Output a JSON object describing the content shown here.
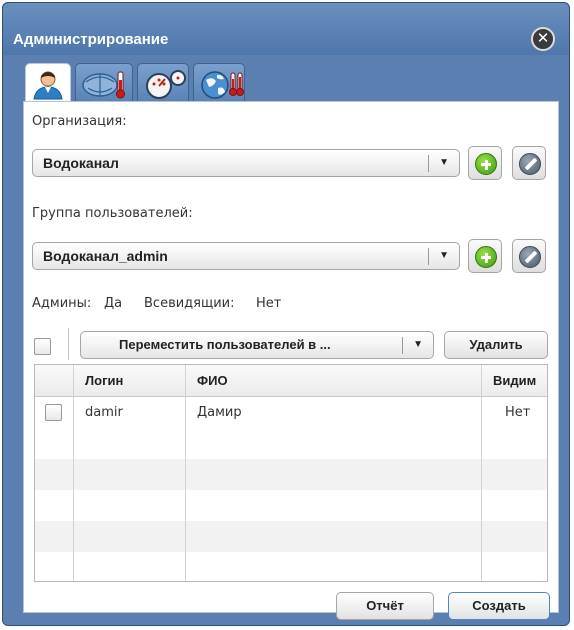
{
  "window": {
    "title": "Администрирование",
    "close_glyph": "✕"
  },
  "tabs": [
    {
      "name": "users",
      "icon": "user-icon",
      "active": true
    },
    {
      "name": "network-settings",
      "icon": "network-thermometer-icon",
      "active": false
    },
    {
      "name": "gauges",
      "icon": "gauges-icon",
      "active": false
    },
    {
      "name": "globe-settings",
      "icon": "globe-thermometer-icon",
      "active": false
    }
  ],
  "organization": {
    "label": "Организация:",
    "selected": "Водоканал"
  },
  "user_group": {
    "label": "Группа пользователей:",
    "selected": "Водоканал_admin"
  },
  "group_info": {
    "admins_label": "Админы:",
    "admins_value": "Да",
    "see_all_label": "Всевидящии:",
    "see_all_value": "Нет"
  },
  "toolbar": {
    "move_label": "Переместить пользователей в ...",
    "delete_label": "Удалить"
  },
  "table": {
    "columns": [
      "Логин",
      "ФИО",
      "Видим"
    ],
    "rows": [
      {
        "login": "damir",
        "name": "Дамир",
        "visible": "Нет"
      }
    ]
  },
  "footer": {
    "report_label": "Отчёт",
    "create_label": "Создать"
  },
  "colors": {
    "title_bar": "#5a7fb0",
    "add_button": "#4caf1a",
    "edit_button": "#5a6776"
  }
}
